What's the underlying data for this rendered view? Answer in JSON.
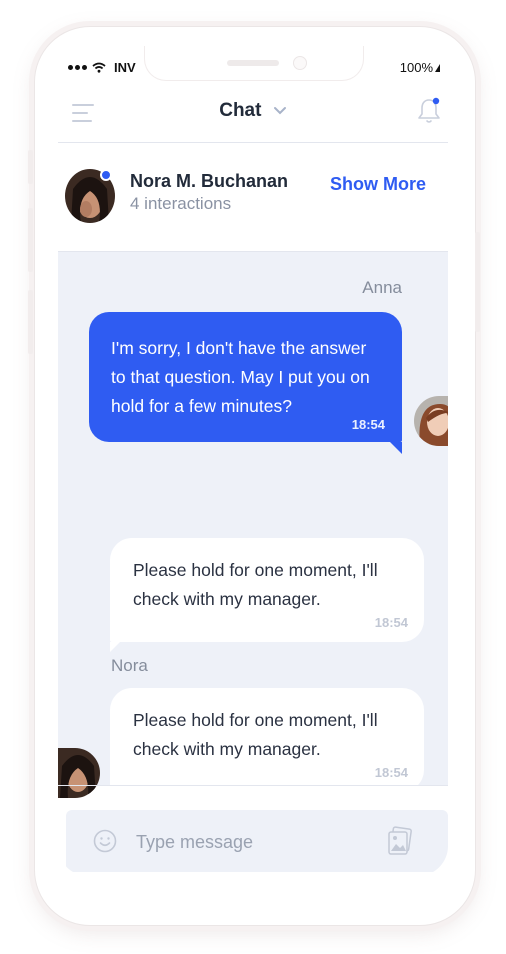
{
  "status_bar": {
    "carrier": "INV",
    "battery": "100%"
  },
  "header": {
    "title": "Chat"
  },
  "contact": {
    "name": "Nora M. Buchanan",
    "subtitle": "4 interactions",
    "show_more_label": "Show More"
  },
  "messages": [
    {
      "sender": "Anna",
      "direction": "outgoing",
      "text": "I'm sorry, I don't have the answer to that question. May I put you on hold for a few minutes?",
      "time": "18:54"
    },
    {
      "direction": "incoming",
      "text": "Please hold for one moment, I'll check with my manager.",
      "time": "18:54"
    },
    {
      "sender": "Nora",
      "direction": "incoming",
      "text": "Please hold for one moment, I'll check with my manager.",
      "time": "18:54"
    }
  ],
  "composer": {
    "placeholder": "Type message"
  },
  "icons": {
    "menu": "menu-icon",
    "chevron": "chevron-down-icon",
    "bell": "bell-icon",
    "emoji": "emoji-icon",
    "attach": "image-attach-icon",
    "signal": "signal-icon",
    "wifi": "wifi-icon",
    "battery": "battery-icon"
  },
  "colors": {
    "accent": "#2f5cf2",
    "chat_bg": "#eef1f8",
    "text_dark": "#222b3a",
    "text_muted": "#8a92a3"
  }
}
